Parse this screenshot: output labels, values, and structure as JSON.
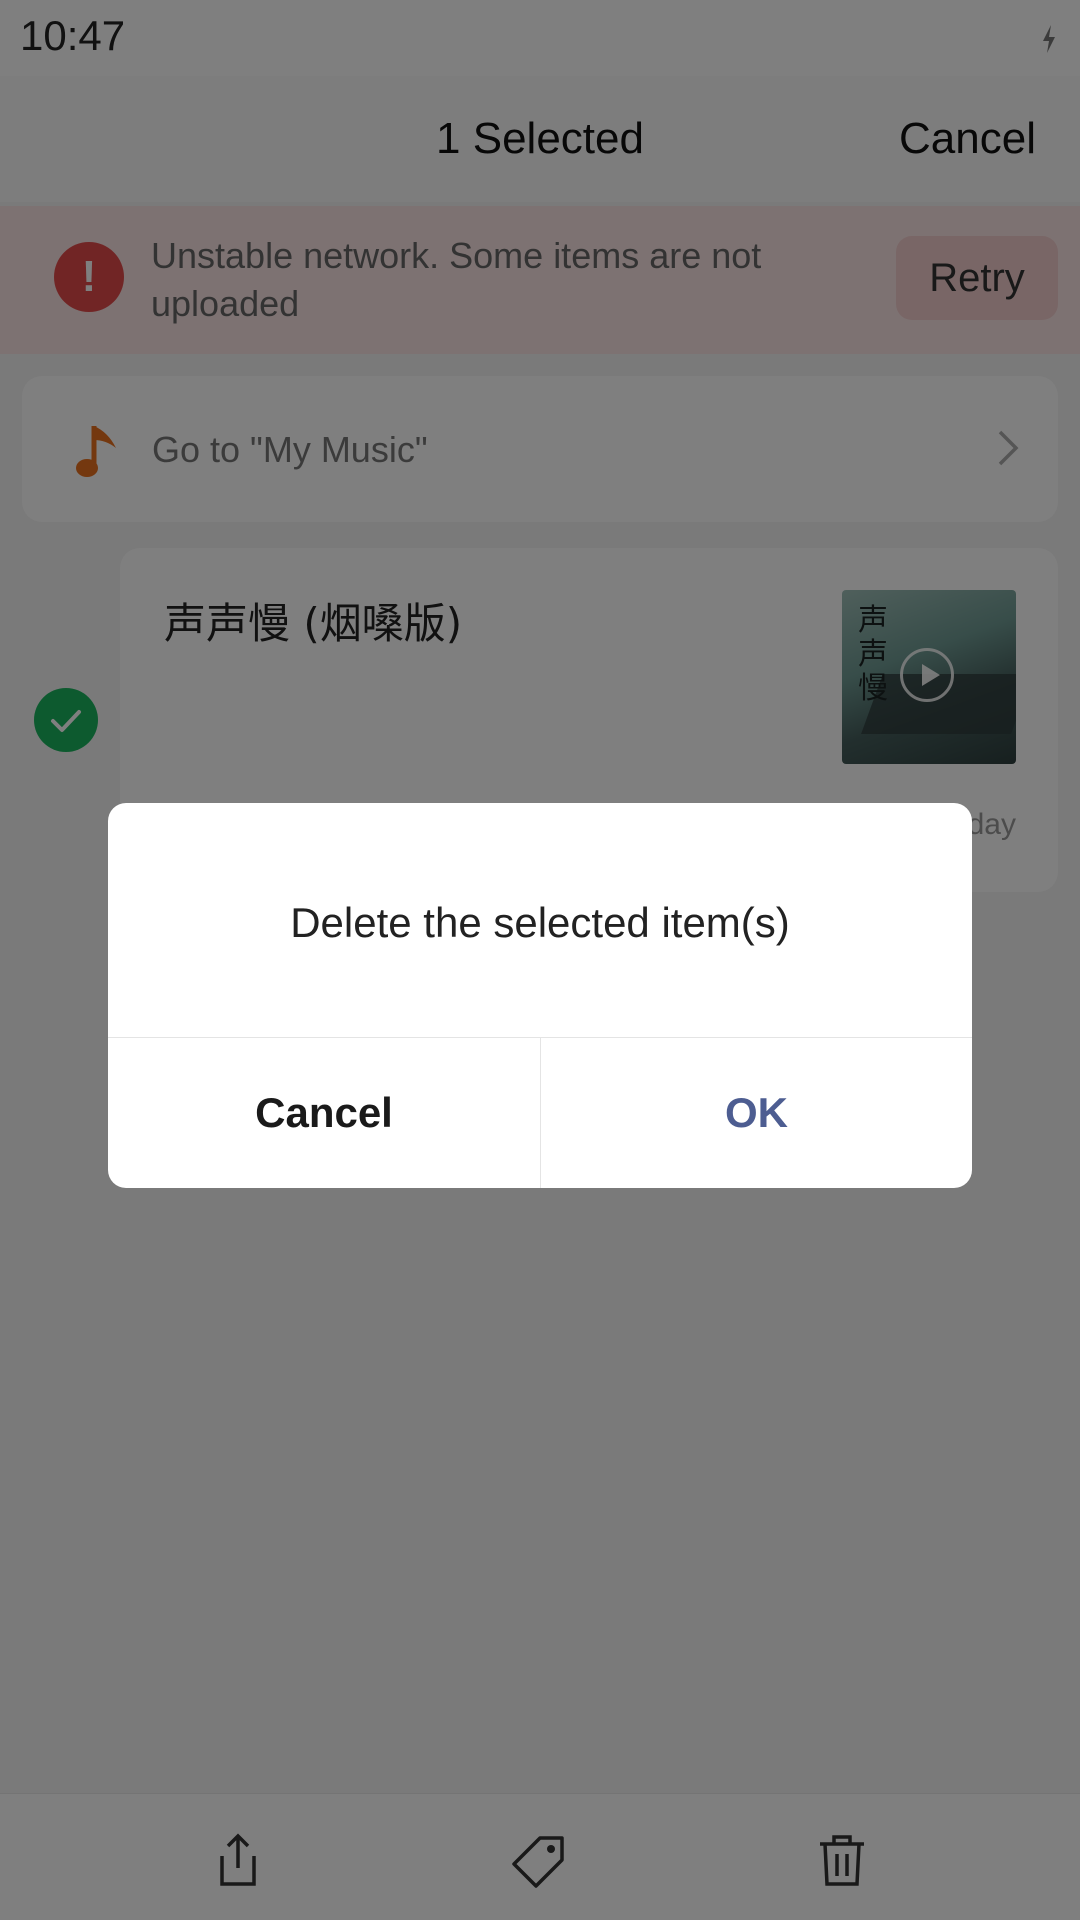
{
  "status_bar": {
    "time": "10:47"
  },
  "header": {
    "title": "1 Selected",
    "cancel_label": "Cancel"
  },
  "banner": {
    "message": "Unstable network. Some items are not uploaded",
    "icon": "!",
    "retry_label": "Retry"
  },
  "music_link": {
    "label": "Go to \"My Music\"",
    "icon": "music-note-icon"
  },
  "item": {
    "title": "声声慢 (烟嗓版)",
    "date": "day",
    "selected": true,
    "thumb_text": "声声慢"
  },
  "dialog": {
    "message": "Delete the selected item(s)",
    "cancel_label": "Cancel",
    "ok_label": "OK"
  },
  "bottom_bar": {
    "icons": [
      "share-icon",
      "tag-icon",
      "trash-icon"
    ]
  },
  "colors": {
    "accent": "#4d5d91",
    "check": "#1bb45f",
    "error": "#e24a4a",
    "music": "#e8701e"
  }
}
